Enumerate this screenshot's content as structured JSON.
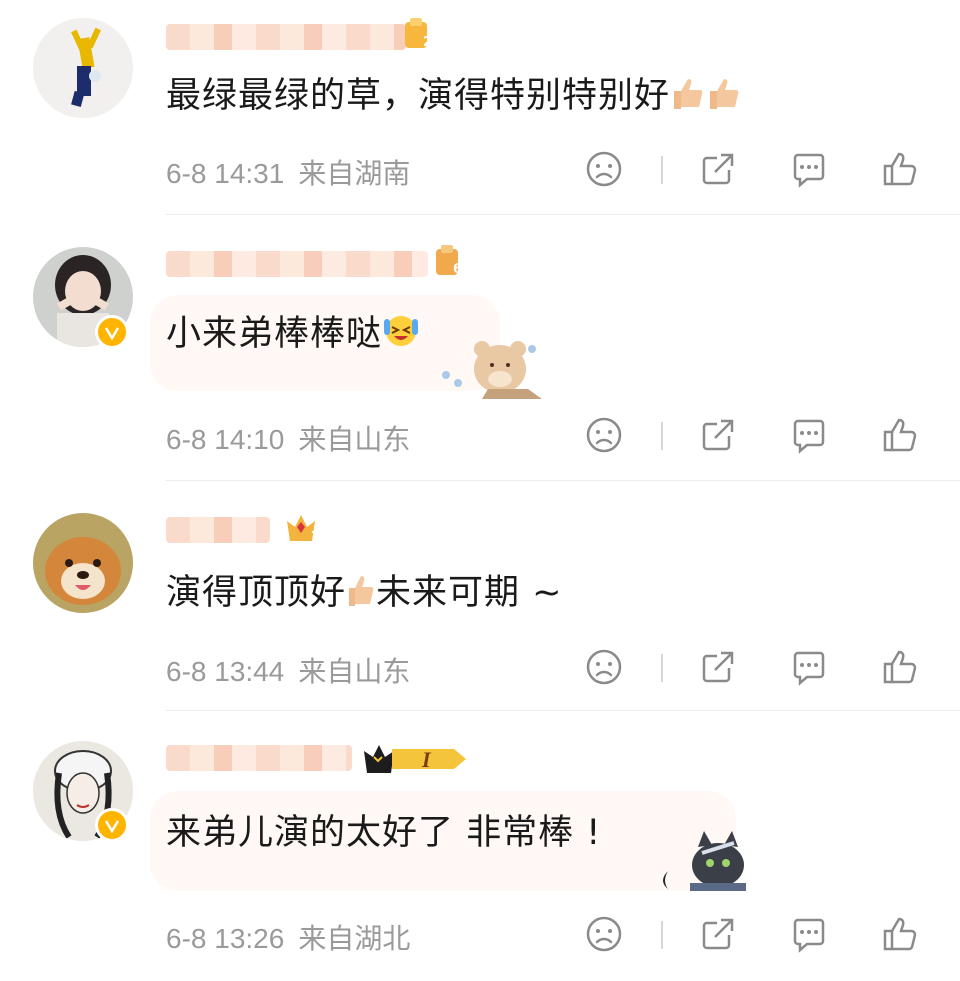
{
  "comments": [
    {
      "text": "最绿最绿的草，演得特别特别好",
      "date": "6-8 14:31",
      "location": "来自湖南",
      "level": "2",
      "emoji": [
        "thumbs-up-emoji",
        "thumbs-up-emoji"
      ]
    },
    {
      "text": "小来弟棒棒哒",
      "date": "6-8 14:10",
      "location": "来自山东",
      "level": "6",
      "emoji": [
        "laughing-tears-emoji"
      ],
      "verified": true
    },
    {
      "text_a": "演得顶顶好",
      "text_b": "未来可期 ~",
      "date": "6-8 13:44",
      "location": "来自山东",
      "level": "7",
      "emoji": [
        "thumbs-up-emoji"
      ]
    },
    {
      "text": "来弟儿演的太好了 非常棒 !",
      "date": "6-8 13:26",
      "location": "来自湖北",
      "level": "I",
      "verified": true
    }
  ],
  "icons": [
    "dislike-icon",
    "share-icon",
    "comment-icon",
    "like-icon"
  ],
  "colors": {
    "meta": "#9a9a9a",
    "badge": "#ffb400",
    "icon": "#8a8a8a"
  }
}
